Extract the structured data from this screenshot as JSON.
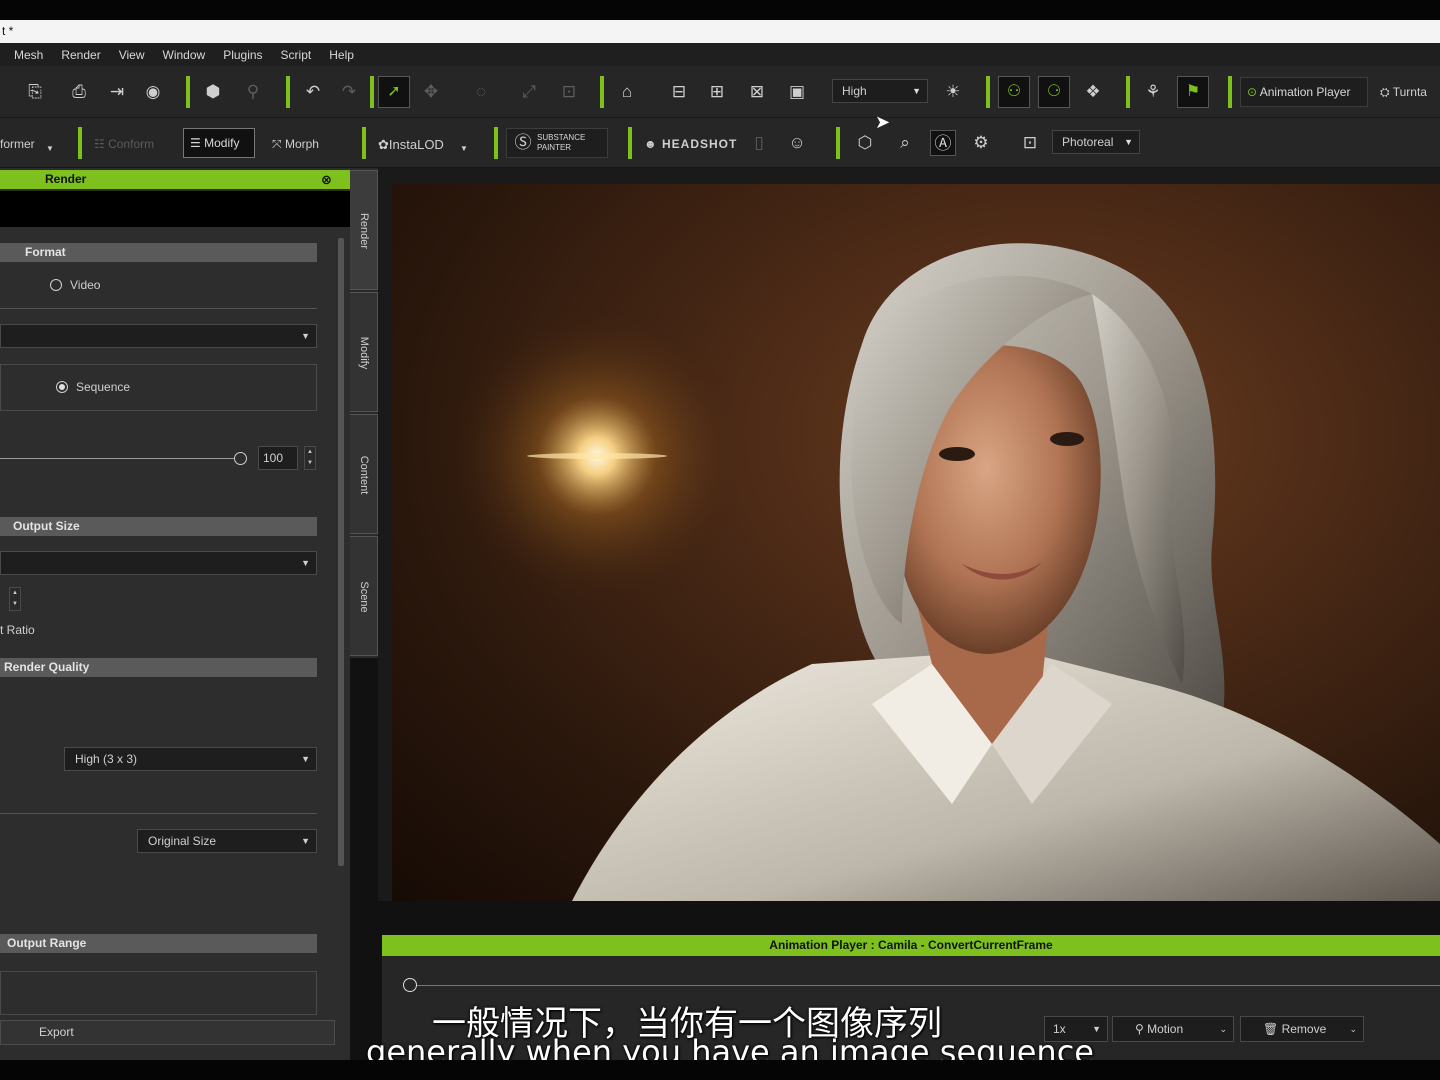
{
  "window": {
    "title": "t *"
  },
  "menu": [
    "Mesh",
    "Render",
    "View",
    "Window",
    "Plugins",
    "Script",
    "Help"
  ],
  "toolbar1": {
    "quality_select": "High",
    "animation_player_label": "Animation Player",
    "turntable_label": "Turnta"
  },
  "toolbar2": {
    "transformer_label": "former",
    "conform_label": "Conform",
    "modify_label": "Modify",
    "morph_label": "Morph",
    "instalod_label": "InstaLOD",
    "substance_label": "SUBSTANCE PAINTER",
    "headshot_label": "HEADSHOT",
    "render_mode_select": "Photoreal"
  },
  "render_panel": {
    "title": "Render",
    "format_section": "Format",
    "video_option": "Video",
    "sequence_option": "Sequence",
    "quality_value": "100",
    "output_size_section": "Output Size",
    "aspect_ratio_label": "t Ratio",
    "render_quality_section": "Render Quality",
    "antialias_select": "High (3 x 3)",
    "size_select": "Original Size",
    "output_range_section": "Output Range",
    "export_button": "Export"
  },
  "side_tabs": [
    "Render",
    "Modify",
    "Content",
    "Scene"
  ],
  "animation_player": {
    "title": "Animation Player : Camila - ConvertCurrentFrame",
    "speed_select": "1x",
    "motion_button": "Motion",
    "remove_button": "Remove"
  },
  "subtitles": {
    "chinese": "一般情况下，当你有一个图像序列",
    "english": "generally when you have an image sequence"
  },
  "colors": {
    "accent": "#7ec11e",
    "panel": "#2d2d2d",
    "toolbar": "#262626"
  }
}
